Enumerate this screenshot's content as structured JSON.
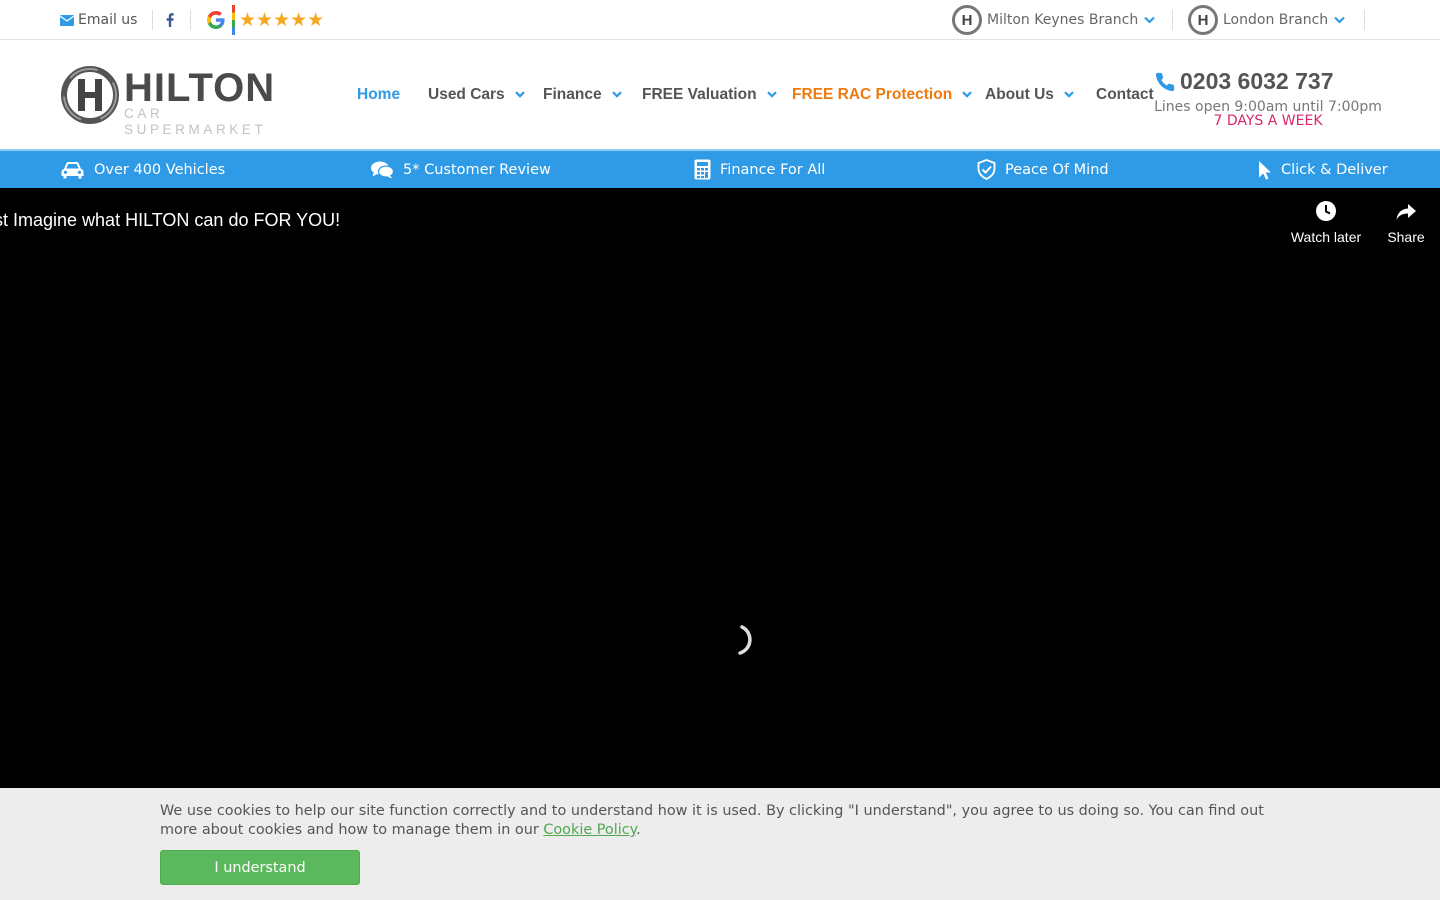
{
  "topbar": {
    "email_label": "Email us",
    "facebook_icon": "facebook-icon",
    "google_icon": "google-g-icon",
    "stars": "★★★★★",
    "branches": [
      {
        "label": "Milton Keynes Branch",
        "icon": "hilton-h-icon"
      },
      {
        "label": "London Branch",
        "icon": "hilton-h-icon"
      }
    ]
  },
  "logo": {
    "title": "HILTON",
    "subtitle": "CAR SUPERMARKET"
  },
  "nav": {
    "home": "Home",
    "used_cars": "Used Cars",
    "finance": "Finance",
    "valuation": "FREE Valuation",
    "rac": "FREE RAC Protection",
    "about": "About Us",
    "contact": "Contact"
  },
  "contact": {
    "phone": "0203 6032 737",
    "hours": "Lines open 9:00am until 7:00pm",
    "days": "7 DAYS A WEEK"
  },
  "features": [
    {
      "label": "Over 400 Vehicles",
      "icon": "car-icon"
    },
    {
      "label": "5* Customer Review",
      "icon": "comments-icon"
    },
    {
      "label": "Finance For All",
      "icon": "calculator-icon"
    },
    {
      "label": "Peace Of Mind",
      "icon": "shield-check-icon"
    },
    {
      "label": "Click & Deliver",
      "icon": "cursor-icon"
    }
  ],
  "video": {
    "title": "ust Imagine what HILTON can do FOR YOU!",
    "watch_later": "Watch later",
    "share": "Share"
  },
  "cookie": {
    "text": "We use cookies to help our site function correctly and to understand how it is used. By clicking \"I understand\", you agree to us doing so. You can find out more about cookies and how to manage them in our ",
    "link": "Cookie Policy",
    "period": ".",
    "button": "I understand"
  },
  "colors": {
    "accent_blue": "#2f9be6",
    "rac_orange": "#ee7b11",
    "days_pink": "#d9286d",
    "cookie_green": "#5cb85c"
  }
}
